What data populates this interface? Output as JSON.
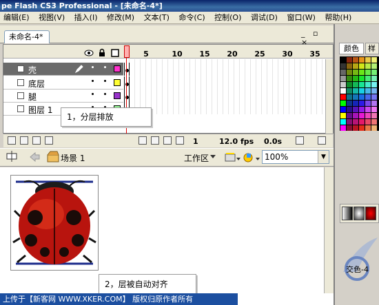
{
  "window": {
    "title": "pe Flash CS3 Professional - [未命名-4*]"
  },
  "menu": [
    "编辑(E)",
    "视图(V)",
    "插入(I)",
    "修改(M)",
    "文本(T)",
    "命令(C)",
    "控制(O)",
    "调试(D)",
    "窗口(W)",
    "帮助(H)"
  ],
  "document": {
    "tab_label": "未命名-4*",
    "window_buttons": "_ ▫ ×"
  },
  "timeline": {
    "frame_numbers": [
      "1",
      "5",
      "10",
      "15",
      "20",
      "25",
      "30",
      "35"
    ],
    "layers": [
      {
        "name": "壳",
        "color": "#ff33cc",
        "selected": true
      },
      {
        "name": "底层",
        "color": "#ffff33",
        "selected": false
      },
      {
        "name": "腿",
        "color": "#9933cc",
        "selected": false
      },
      {
        "name": "图层 1",
        "color": "#99ff99",
        "selected": false
      }
    ],
    "current_frame": "1",
    "fps": "12.0 fps",
    "time": "0.0s"
  },
  "annotations": {
    "callout1": "1，分层排放",
    "callout2": "2，层被自动对齐"
  },
  "scene": {
    "label": "场景 1",
    "workspace": "工作区",
    "zoom": "100%"
  },
  "right_panel": {
    "tab1": "颜色",
    "tab2": "样",
    "bottom_text": "交色-4"
  },
  "watermark": "上传于【新客网 WWW.XKER.COM】 版权归原作者所有",
  "icons": [
    "eye-icon",
    "lock-icon",
    "outline-icon",
    "pencil-icon",
    "layer-icon",
    "back-arrow-icon",
    "scene-icon",
    "edit-symbols-icon",
    "edit-scene-icon",
    "trash-icon",
    "add-layer-icon"
  ]
}
